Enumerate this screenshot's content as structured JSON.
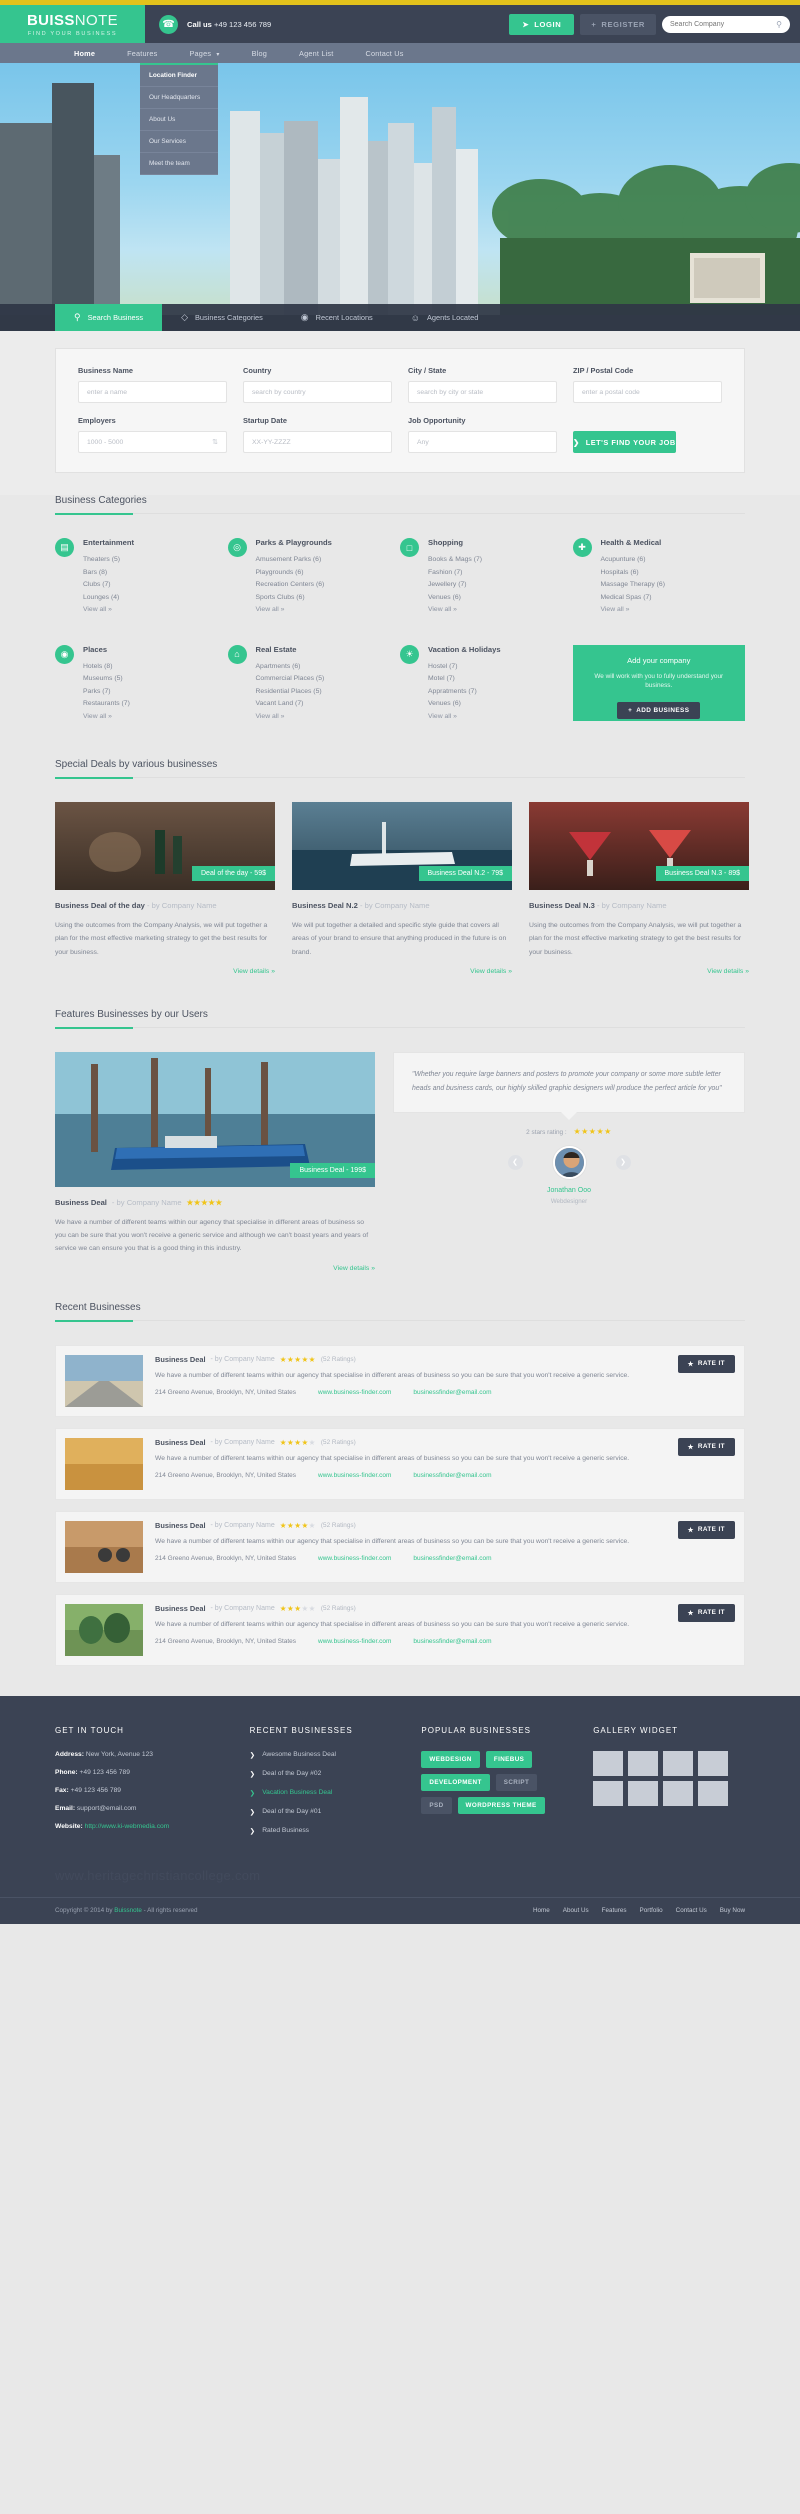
{
  "header": {
    "logo_main": "BUISS",
    "logo_main_light": "NOTE",
    "logo_sub": "FIND YOUR BUSINESS",
    "call_label": "Call us",
    "call_number": "+49 123 456 789",
    "login_label": "LOGIN",
    "register_label": "REGISTER",
    "search_placeholder": "Search Company"
  },
  "nav": {
    "items": [
      {
        "label": "Home",
        "active": true,
        "caret": false
      },
      {
        "label": "Features",
        "active": false,
        "caret": false
      },
      {
        "label": "Pages",
        "active": false,
        "caret": true
      },
      {
        "label": "Blog",
        "active": false,
        "caret": false
      },
      {
        "label": "Agent List",
        "active": false,
        "caret": false
      },
      {
        "label": "Contact Us",
        "active": false,
        "caret": false
      }
    ],
    "dropdown": [
      "Location Finder",
      "Our Headquarters",
      "About Us",
      "Our Services",
      "Meet the team"
    ]
  },
  "search_tabs": [
    {
      "label": "Search Business",
      "icon": "search-icon",
      "active": true
    },
    {
      "label": "Business Categories",
      "icon": "tag-icon",
      "active": false
    },
    {
      "label": "Recent Locations",
      "icon": "pin-icon",
      "active": false
    },
    {
      "label": "Agents Located",
      "icon": "user-icon",
      "active": false
    }
  ],
  "search_form": {
    "row1": [
      {
        "label": "Business Name",
        "placeholder": "enter a name",
        "spinner": false
      },
      {
        "label": "Country",
        "placeholder": "search by country",
        "spinner": false
      },
      {
        "label": "City / State",
        "placeholder": "search by city or state",
        "spinner": false
      },
      {
        "label": "ZIP / Postal Code",
        "placeholder": "enter a postal code",
        "spinner": false
      }
    ],
    "row2": [
      {
        "label": "Employers",
        "placeholder": "1000 - 5000",
        "spinner": true
      },
      {
        "label": "Startup Date",
        "placeholder": "XX-YY-ZZZZ",
        "spinner": false
      },
      {
        "label": "Job Opportunity",
        "placeholder": "Any",
        "spinner": false
      }
    ],
    "submit_label": "LET'S FIND YOUR JOB"
  },
  "categories": {
    "title": "Business Categories",
    "items": [
      {
        "name": "Entertainment",
        "icon": "film-icon",
        "links": [
          "Theaters (5)",
          "Bars (8)",
          "Clubs (7)",
          "Lounges (4)",
          "View all »"
        ]
      },
      {
        "name": "Parks & Playgrounds",
        "icon": "circle-icon",
        "links": [
          "Amusement Parks (6)",
          "Playgrounds (6)",
          "Recreation Centers (6)",
          "Sports Clubs (6)",
          "View all »"
        ]
      },
      {
        "name": "Shopping",
        "icon": "bag-icon",
        "links": [
          "Books & Mags (7)",
          "Fashion (7)",
          "Jewellery (7)",
          "Venues (6)",
          "View all »"
        ]
      },
      {
        "name": "Health & Medical",
        "icon": "cross-icon",
        "links": [
          "Acupunture (6)",
          "Hospitals (6)",
          "Massage Therapy (6)",
          "Medical Spas (7)",
          "View all »"
        ]
      },
      {
        "name": "Places",
        "icon": "pin-icon",
        "links": [
          "Hotels (8)",
          "Museums (5)",
          "Parks (7)",
          "Restaurants (7)",
          "View all »"
        ]
      },
      {
        "name": "Real Estate",
        "icon": "home-icon",
        "links": [
          "Apartments (6)",
          "Commercial Places (5)",
          "Residential Places (5)",
          "Vacant Land (7)",
          "View all »"
        ]
      },
      {
        "name": "Vacation & Holidays",
        "icon": "sun-icon",
        "links": [
          "Hostel (7)",
          "Motel (7)",
          "Appratments (7)",
          "Venues (6)",
          "View all »"
        ]
      }
    ],
    "addbox": {
      "title": "Add your company",
      "text": "We will work with you to fully understand your business.",
      "button": "ADD BUSINESS"
    }
  },
  "deals": {
    "title": "Special Deals by various businesses",
    "items": [
      {
        "tag": "Deal of the day - 59$",
        "title": "Business Deal of the day",
        "by": "- by Company Name",
        "text": "Using the outcomes from the Company Analysis, we will put together a plan for the most effective marketing strategy to get the best results for your business.",
        "view": "View details »"
      },
      {
        "tag": "Business Deal N.2 - 79$",
        "title": "Business Deal N.2",
        "by": "- by Company Name",
        "text": "We will put together a detailed and specific style guide that covers all areas of your brand to ensure that anything produced in the future is on brand.",
        "view": "View details »"
      },
      {
        "tag": "Business Deal N.3 - 89$",
        "title": "Business Deal N.3",
        "by": "- by Company Name",
        "text": "Using the outcomes from the Company Analysis, we will put together a plan for the most effective marketing strategy to get the best results for your business.",
        "view": "View details »"
      }
    ]
  },
  "featured": {
    "title": "Features Businesses by our Users",
    "tag": "Business Deal - 199$",
    "deal_title": "Business Deal",
    "deal_by": "- by Company Name",
    "deal_stars": 5,
    "deal_text": "We have a number of different teams within our agency that specialise in different areas of business so you can be sure that you won't receive a generic service and although we can't boast years and years of service we can ensure you that is a good thing in this industry.",
    "view": "View details »",
    "quote": "\"Whether you require large banners and posters to promote your company or some more subtle letter heads and business cards, our highly skilled graphic designers will produce the perfect article for you\"",
    "rating_label": "2 stars rating :",
    "rating_stars": 5,
    "author_name": "Jonathan Ooo",
    "author_role": "Webdesigner"
  },
  "recent": {
    "title": "Recent Businesses",
    "rate_label": "RATE IT",
    "rows": [
      {
        "title": "Business Deal",
        "by": "- by Company Name",
        "stars": 5,
        "count": "(52 Ratings)",
        "text": "We have a number of different teams within our agency that specialise in different areas of business so you can be sure that you won't receive a generic service.",
        "address": "214 Greeno Avenue, Brooklyn, NY, United States",
        "site": "www.business-finder.com",
        "email": "businessfinder@email.com"
      },
      {
        "title": "Business Deal",
        "by": "- by Company Name",
        "stars": 4,
        "count": "(52 Ratings)",
        "text": "We have a number of different teams within our agency that specialise in different areas of business so you can be sure that you won't receive a generic service.",
        "address": "214 Greeno Avenue, Brooklyn, NY, United States",
        "site": "www.business-finder.com",
        "email": "businessfinder@email.com"
      },
      {
        "title": "Business Deal",
        "by": "- by Company Name",
        "stars": 4,
        "count": "(52 Ratings)",
        "text": "We have a number of different teams within our agency that specialise in different areas of business so you can be sure that you won't receive a generic service.",
        "address": "214 Greeno Avenue, Brooklyn, NY, United States",
        "site": "www.business-finder.com",
        "email": "businessfinder@email.com"
      },
      {
        "title": "Business Deal",
        "by": "- by Company Name",
        "stars": 3,
        "count": "(52 Ratings)",
        "text": "We have a number of different teams within our agency that specialise in different areas of business so you can be sure that you won't receive a generic service.",
        "address": "214 Greeno Avenue, Brooklyn, NY, United States",
        "site": "www.business-finder.com",
        "email": "businessfinder@email.com"
      }
    ]
  },
  "footer": {
    "touch_title": "GET IN TOUCH",
    "touch": [
      {
        "key": "Address:",
        "val": " New York, Avenue 123",
        "link": false
      },
      {
        "key": "Phone:",
        "val": " +49 123 456 789",
        "link": false
      },
      {
        "key": "Fax:",
        "val": " +49 123 456 789",
        "link": false
      },
      {
        "key": "Email:",
        "val": " support@email.com",
        "link": false
      },
      {
        "key": "Website:",
        "val": " http://www.ki-webmedia.com",
        "link": true
      }
    ],
    "recent_title": "RECENT BUSINESSES",
    "recent": [
      {
        "label": "Awesome Business Deal",
        "green": false
      },
      {
        "label": "Deal of the Day #02",
        "green": false
      },
      {
        "label": "Vacation Business Deal",
        "green": true
      },
      {
        "label": "Deal of the Day #01",
        "green": false
      },
      {
        "label": "Rated Business",
        "green": false
      }
    ],
    "popular_title": "POPULAR BUSINESSES",
    "tags": [
      {
        "label": "WEBDESIGN",
        "style": "g"
      },
      {
        "label": "FINEBUS",
        "style": "g"
      },
      {
        "label": "DEVELOPMENT",
        "style": "g"
      },
      {
        "label": "SCRIPT",
        "style": "d"
      },
      {
        "label": "PSD",
        "style": "d"
      },
      {
        "label": "WORDPRESS THEME",
        "style": "g"
      }
    ],
    "gallery_title": "GALLERY WIDGET",
    "gallery_cells": 8,
    "watermark": "www.heritagechristiancollege.com",
    "copyright": "Copyright © 2014 by ",
    "copyright_link": "Buissnote",
    "copyright_rest": " - All rights reserved",
    "bottom_nav": [
      "Home",
      "About Us",
      "Features",
      "Portfolio",
      "Contact Us",
      "Buy Now"
    ]
  }
}
